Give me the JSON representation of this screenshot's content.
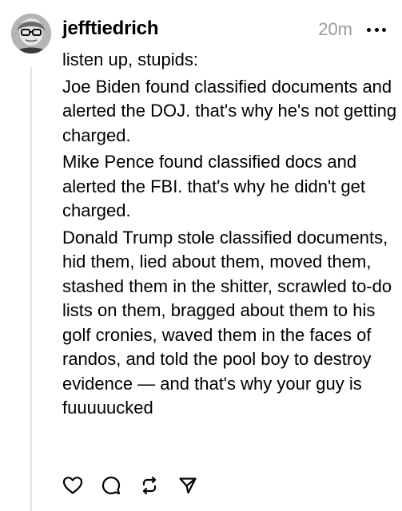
{
  "post": {
    "author": {
      "username": "jefftiedrich",
      "avatar_icon": "avatar-photo"
    },
    "timestamp": "20m",
    "menu_icon": "more-horizontal-icon",
    "paragraphs": [
      "listen up, stupids:",
      "Joe Biden found classified documents and alerted the DOJ. that's why he's not getting charged.",
      "Mike Pence found classified docs and alerted the FBI. that's why he didn't get charged.",
      "Donald Trump stole classified documents, hid them, lied about them, moved them, stashed them in the shitter, scrawled to-do lists on them, bragged about them to his golf cronies, waved them in the faces of randos, and told the pool boy to destroy evidence — and that's why your guy is fuuuuucked"
    ]
  },
  "actions": [
    {
      "name": "like",
      "icon": "heart-icon"
    },
    {
      "name": "reply",
      "icon": "comment-icon"
    },
    {
      "name": "repost",
      "icon": "repost-icon"
    },
    {
      "name": "share",
      "icon": "send-icon"
    }
  ],
  "colors": {
    "text": "#000000",
    "muted": "#9a9a9a",
    "thread_line": "#e3e3e3",
    "background": "#ffffff"
  }
}
